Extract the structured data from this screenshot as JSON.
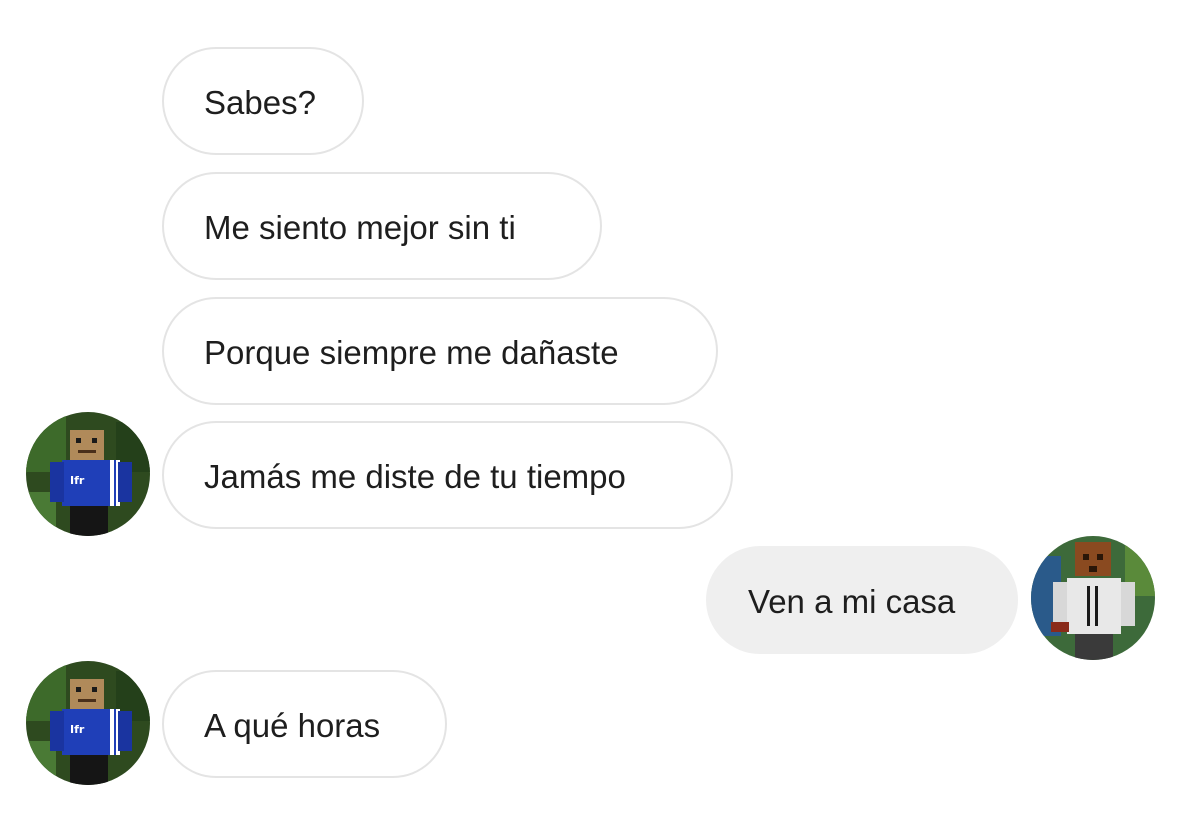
{
  "conversation": {
    "messages": [
      {
        "sender": "other",
        "text": "Sabes?"
      },
      {
        "sender": "other",
        "text": "Me siento mejor sin ti"
      },
      {
        "sender": "other",
        "text": "Porque siempre me dañaste"
      },
      {
        "sender": "other",
        "text": "Jamás me diste de tu tiempo"
      },
      {
        "sender": "me",
        "text": "Ven a mi casa"
      },
      {
        "sender": "other",
        "text": "A qué horas"
      }
    ]
  },
  "avatars": {
    "other": {
      "icon": "minecraft-skin-blue-avatar",
      "shirt_color": "#1f3fb8",
      "shirt_text": "Ifr"
    },
    "me": {
      "icon": "minecraft-skin-white-avatar",
      "shirt_color": "#e8e8e8"
    }
  },
  "colors": {
    "incoming_bubble": "#ffffff",
    "incoming_border": "#e4e4e4",
    "outgoing_bubble": "#efefef",
    "text": "#1e1e1e"
  }
}
